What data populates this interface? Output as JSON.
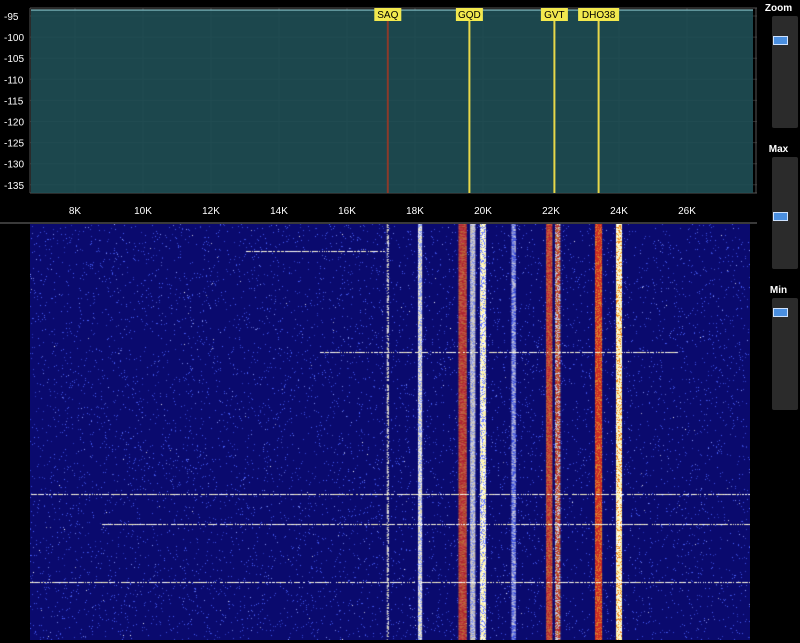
{
  "spectrum": {
    "y_ticks": [
      "-95",
      "-100",
      "-105",
      "-110",
      "-115",
      "-120",
      "-125",
      "-130",
      "-135"
    ],
    "x_ticks": [
      "8K",
      "10K",
      "12K",
      "14K",
      "16K",
      "18K",
      "20K",
      "22K",
      "24K",
      "26K"
    ],
    "markers": [
      {
        "label": "SAQ",
        "freq_k": 17.2,
        "color": "#8b3a2a"
      },
      {
        "label": "GQD",
        "freq_k": 19.6,
        "color": "#e8d84a"
      },
      {
        "label": "GVT",
        "freq_k": 22.1,
        "color": "#e8d84a"
      },
      {
        "label": "DHO38",
        "freq_k": 23.4,
        "color": "#e8d84a"
      }
    ],
    "colors": {
      "trace": "#9fe0e8",
      "fill": "#1f4f55",
      "grid": "#2c2c2c",
      "marker_bg": "#f2e94e"
    }
  },
  "controls": {
    "zoom": {
      "label": "Zoom",
      "level": 0.2
    },
    "max": {
      "label": "Max",
      "level": 0.55
    },
    "min": {
      "label": "Min",
      "level": 0.1
    }
  },
  "waterfall": {
    "colors": {
      "background": "#0a0a6e",
      "speckle": "#4a63ff",
      "red": "#e0301e",
      "orange": "#f08a24",
      "cream": "#f8f0c0"
    }
  }
}
